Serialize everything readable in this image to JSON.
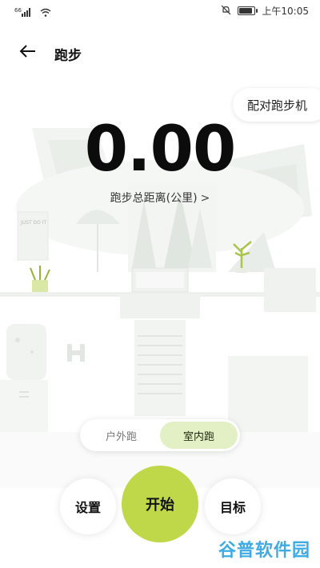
{
  "status_bar": {
    "time": "上午10:05",
    "signal_label": "⁶⁶"
  },
  "header": {
    "title": "跑步",
    "back_icon": "arrow-left-icon"
  },
  "pair_button": {
    "label": "配对跑步机"
  },
  "distance": {
    "value": "0.00",
    "label": "跑步总距离(公里)",
    "chevron": ">"
  },
  "illustration_poster": "JUST DO IT",
  "mode_toggle": {
    "options": [
      {
        "label": "户外跑",
        "active": false
      },
      {
        "label": "室内跑",
        "active": true
      }
    ]
  },
  "actions": {
    "settings_label": "设置",
    "start_label": "开始",
    "goal_label": "目标"
  },
  "watermark": "谷普软件园",
  "colors": {
    "accent": "#bfd849",
    "toggle_active_bg": "#e3efc4",
    "watermark": "#2aa2e3"
  }
}
